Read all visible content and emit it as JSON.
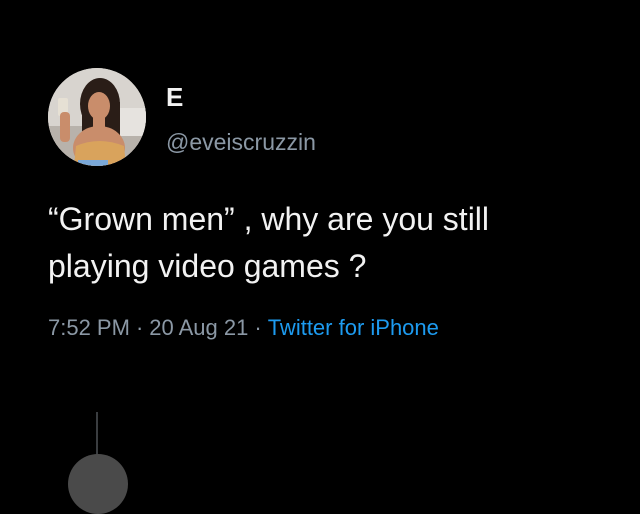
{
  "tweet": {
    "display_name": "E",
    "handle": "@eveiscruzzin",
    "text_line1": "“Grown men” , why are you still",
    "text_line2": "playing video games ?",
    "time": "7:52 PM",
    "separator": "·",
    "date": "20 Aug 21",
    "source": "Twitter for iPhone"
  },
  "colors": {
    "background": "#000000",
    "text": "#f2f2f2",
    "secondary_text": "#8b98a5",
    "link": "#1d9bf0"
  },
  "icons": {
    "avatar": "profile-photo",
    "next_avatar": "profile-photo-partial"
  }
}
